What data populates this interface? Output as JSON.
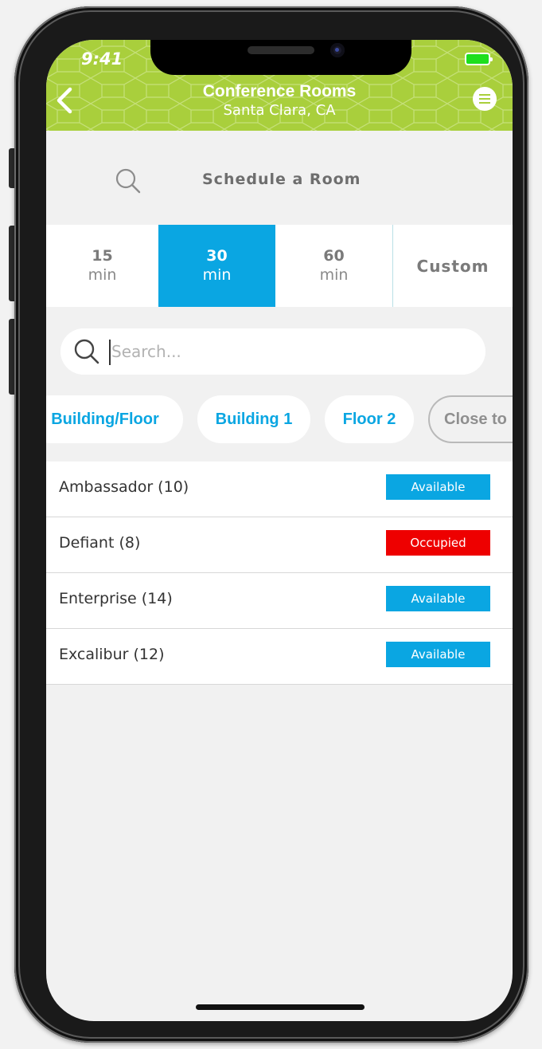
{
  "status_bar": {
    "time": "9:41"
  },
  "header": {
    "title": "Conference Rooms",
    "subtitle": "Santa Clara, CA"
  },
  "schedule": {
    "label": "Schedule a Room"
  },
  "durations": [
    {
      "value": "15",
      "unit": "min",
      "selected": false
    },
    {
      "value": "30",
      "unit": "min",
      "selected": true
    },
    {
      "value": "60",
      "unit": "min",
      "selected": false
    },
    {
      "value": "Custom",
      "unit": "",
      "selected": false
    }
  ],
  "search": {
    "placeholder": "Search..."
  },
  "filters": [
    {
      "label": "Building/Floor"
    },
    {
      "label": "Building 1"
    },
    {
      "label": "Floor 2"
    },
    {
      "label": "Close to"
    }
  ],
  "rooms": [
    {
      "name": "Ambassador (10)",
      "status": "Available"
    },
    {
      "name": "Defiant (8)",
      "status": "Occupied"
    },
    {
      "name": "Enterprise (14)",
      "status": "Available"
    },
    {
      "name": "Excalibur (12)",
      "status": "Available"
    }
  ],
  "colors": {
    "header_green": "#a9cf3c",
    "accent_blue": "#0aa6e2",
    "occupied_red": "#ee0000",
    "battery_green": "#1edf1e"
  },
  "icons": [
    "back-chevron-icon",
    "menu-icon",
    "search-icon",
    "battery-icon"
  ]
}
